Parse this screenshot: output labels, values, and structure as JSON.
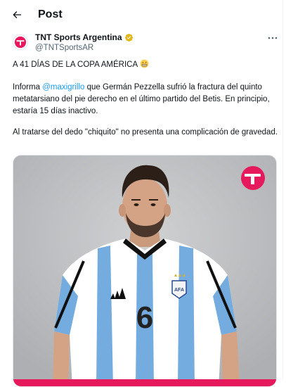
{
  "header": {
    "back_icon": "arrow-left-icon",
    "title": "Post"
  },
  "tweet": {
    "author_name": "TNT Sports Argentina",
    "verified_badge": "gold-verified-badge-icon",
    "handle": "@TNTSportsAR",
    "more_icon": "more-horizontal-icon",
    "paragraph1": "A 41 DÍAS DE LA COPA AMÉRICA",
    "paragraph1_emoji": "grimacing-face-emoji",
    "paragraph2_prefix": "Informa ",
    "paragraph2_mention": "@maxigrillo",
    "paragraph2_suffix": " que Germán Pezzella sufrió la fractura del quinto metatarsiano del pie derecho en el último partido del Betis. En principio, estaría 15 días inactivo.",
    "paragraph3": "Al tratarse del dedo \"chiquito\" no presenta una complicación de gravedad.",
    "media_description_icon": "photo"
  },
  "colors": {
    "brand_pink": "#e5195c",
    "link_blue": "#1d9bf0",
    "secondary_text": "#536471",
    "jersey_blue": "#74acdf"
  },
  "media": {
    "jersey_number": "6",
    "badge_text": "AFA"
  }
}
